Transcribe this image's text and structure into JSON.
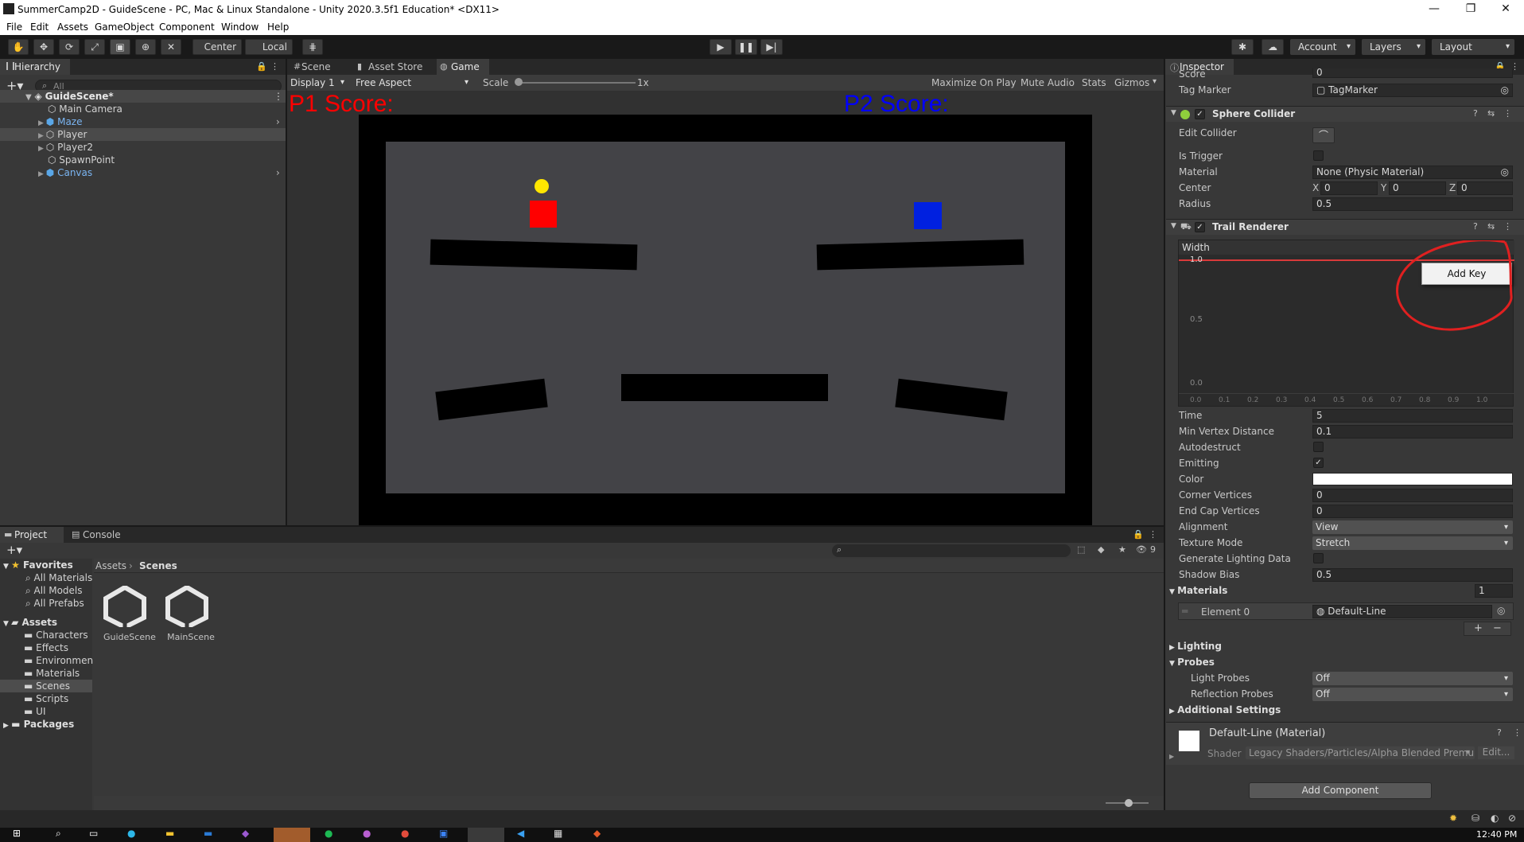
{
  "window": {
    "title": "SummerCamp2D - GuideScene - PC, Mac & Linux Standalone - Unity 2020.3.5f1 Education* <DX11>",
    "controls": [
      "—",
      "❐",
      "✕"
    ]
  },
  "menu": [
    "File",
    "Edit",
    "Assets",
    "GameObject",
    "Component",
    "Window",
    "Help"
  ],
  "toolbar": {
    "pivot": "Center",
    "space": "Local",
    "account": "Account",
    "layers": "Layers",
    "layout": "Layout"
  },
  "hierarchy": {
    "tab": "Hierarchy",
    "search_placeholder": "All",
    "scene": "GuideScene*",
    "items": [
      "Main Camera",
      "Maze",
      "Player",
      "Player2",
      "SpawnPoint",
      "Canvas"
    ]
  },
  "scene_tabs": [
    "Scene",
    "Asset Store",
    "Game"
  ],
  "game_bar": {
    "display": "Display 1",
    "aspect": "Free Aspect",
    "scale_label": "Scale",
    "scale_value": "1x",
    "maximize": "Maximize On Play",
    "mute": "Mute Audio",
    "stats": "Stats",
    "gizmos": "Gizmos"
  },
  "game_view": {
    "p1_score": "P1 Score:",
    "p2_score": "P2 Score:",
    "colors": {
      "p1": "#ff0000",
      "p2": "#0000ff",
      "ball": "#ffe600",
      "arena": "#434347",
      "wall": "#000000"
    }
  },
  "bottom_tabs": [
    "Project",
    "Console"
  ],
  "project": {
    "favorites_label": "Favorites",
    "favorites": [
      "All Materials",
      "All Models",
      "All Prefabs"
    ],
    "assets_label": "Assets",
    "folders": [
      "Characters",
      "Effects",
      "Environmen",
      "Materials",
      "Scenes",
      "Scripts",
      "UI"
    ],
    "packages_label": "Packages",
    "breadcrumb": [
      "Assets",
      "Scenes"
    ],
    "files": [
      "GuideScene",
      "MainScene"
    ],
    "hidden_count": "9"
  },
  "inspector": {
    "tab": "Inspector",
    "score_label": "Score",
    "score_value": "0",
    "tag_marker_label": "Tag Marker",
    "tag_marker_value": "TagMarker",
    "sphere_collider": {
      "title": "Sphere Collider",
      "edit_collider": "Edit Collider",
      "is_trigger": "Is Trigger",
      "material_label": "Material",
      "material_value": "None (Physic Material)",
      "center_label": "Center",
      "center": {
        "x": "0",
        "y": "0",
        "z": "0"
      },
      "radius_label": "Radius",
      "radius_value": "0.5"
    },
    "trail_renderer": {
      "title": "Trail Renderer",
      "width_label": "Width",
      "curve_value_label": "1.0",
      "y_ticks": [
        "1.0",
        "0.5",
        "0.0"
      ],
      "x_ticks": [
        "0.0",
        "0.1",
        "0.2",
        "0.3",
        "0.4",
        "0.5",
        "0.6",
        "0.7",
        "0.8",
        "0.9",
        "1.0"
      ],
      "context_menu_item": "Add Key",
      "props": [
        {
          "label": "Time",
          "value": "5"
        },
        {
          "label": "Min Vertex Distance",
          "value": "0.1"
        }
      ],
      "autodestruct": "Autodestruct",
      "emitting": "Emitting",
      "color_label": "Color",
      "color_value": "#ffffff",
      "corner_vertices_label": "Corner Vertices",
      "corner_vertices": "0",
      "end_cap_label": "End Cap Vertices",
      "end_cap": "0",
      "alignment_label": "Alignment",
      "alignment": "View",
      "texture_mode_label": "Texture Mode",
      "texture_mode": "Stretch",
      "gen_lighting": "Generate Lighting Data",
      "shadow_bias_label": "Shadow Bias",
      "shadow_bias": "0.5",
      "materials_label": "Materials",
      "materials_count": "1",
      "element0_label": "Element 0",
      "element0_value": "Default-Line",
      "lighting": "Lighting",
      "probes": "Probes",
      "light_probes_label": "Light Probes",
      "light_probes": "Off",
      "reflection_probes_label": "Reflection Probes",
      "reflection_probes": "Off",
      "additional": "Additional Settings"
    },
    "material_preview": {
      "name": "Default-Line (Material)",
      "shader_label": "Shader",
      "shader": "Legacy Shaders/Particles/Alpha Blended Premu",
      "edit": "Edit..."
    },
    "add_component": "Add Component"
  },
  "taskbar": {
    "time": "12:40 PM"
  }
}
